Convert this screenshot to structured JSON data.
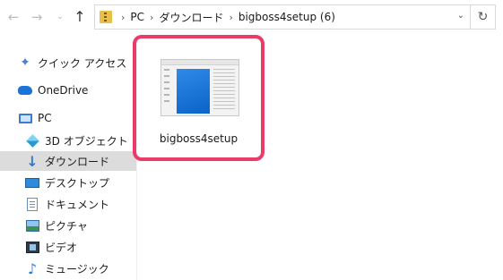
{
  "nav": {
    "back_icon": "arrow-left-icon",
    "forward_icon": "arrow-right-icon",
    "recent_icon": "chevron-down-icon",
    "up_icon": "arrow-up-icon"
  },
  "address": {
    "crumbs": [
      "PC",
      "ダウンロード",
      "bigboss4setup (6)"
    ],
    "dropdown_icon": "chevron-down-icon",
    "refresh_icon": "refresh-icon"
  },
  "sidebar": {
    "items": [
      {
        "label": "クイック アクセス",
        "icon": "star-icon",
        "selected": false
      },
      {
        "label": "OneDrive",
        "icon": "cloud-icon",
        "selected": false
      },
      {
        "label": "PC",
        "icon": "computer-icon",
        "selected": false
      },
      {
        "label": "3D オブジェクト",
        "icon": "3d-objects-icon",
        "selected": false
      },
      {
        "label": "ダウンロード",
        "icon": "download-icon",
        "selected": true
      },
      {
        "label": "デスクトップ",
        "icon": "desktop-icon",
        "selected": false
      },
      {
        "label": "ドキュメント",
        "icon": "document-icon",
        "selected": false
      },
      {
        "label": "ピクチャ",
        "icon": "picture-icon",
        "selected": false
      },
      {
        "label": "ビデオ",
        "icon": "video-icon",
        "selected": false
      },
      {
        "label": "ミュージック",
        "icon": "music-icon",
        "selected": false
      }
    ]
  },
  "content": {
    "file": {
      "name": "bigboss4setup",
      "icon": "installer-thumbnail-icon"
    }
  },
  "colors": {
    "highlight": "#ec3b6b",
    "selected_bg": "#dcdcdc"
  }
}
